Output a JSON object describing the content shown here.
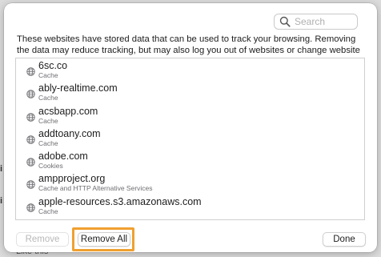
{
  "search": {
    "placeholder": "Search"
  },
  "description": "These websites have stored data that can be used to track your browsing. Removing the data may reduce tracking, but may also log you out of websites or change website behavior.",
  "websites": [
    {
      "site": "6sc.co",
      "detail": "Cache"
    },
    {
      "site": "ably-realtime.com",
      "detail": "Cache"
    },
    {
      "site": "acsbapp.com",
      "detail": "Cache"
    },
    {
      "site": "addtoany.com",
      "detail": "Cache"
    },
    {
      "site": "adobe.com",
      "detail": "Cookies"
    },
    {
      "site": "ampproject.org",
      "detail": "Cache and HTTP Alternative Services"
    },
    {
      "site": "apple-resources.s3.amazonaws.com",
      "detail": "Cache"
    }
  ],
  "buttons": {
    "remove": "Remove",
    "remove_all": "Remove All",
    "done": "Done"
  },
  "background": {
    "fragment_a": "i",
    "fragment_b": "i",
    "fragment_c": "Like this"
  },
  "colors": {
    "highlight": "#f0a030",
    "sheet": "#ffffff",
    "list_border": "#cfcfcf"
  },
  "icons": {
    "search": "search-icon",
    "site": "globe-icon"
  }
}
